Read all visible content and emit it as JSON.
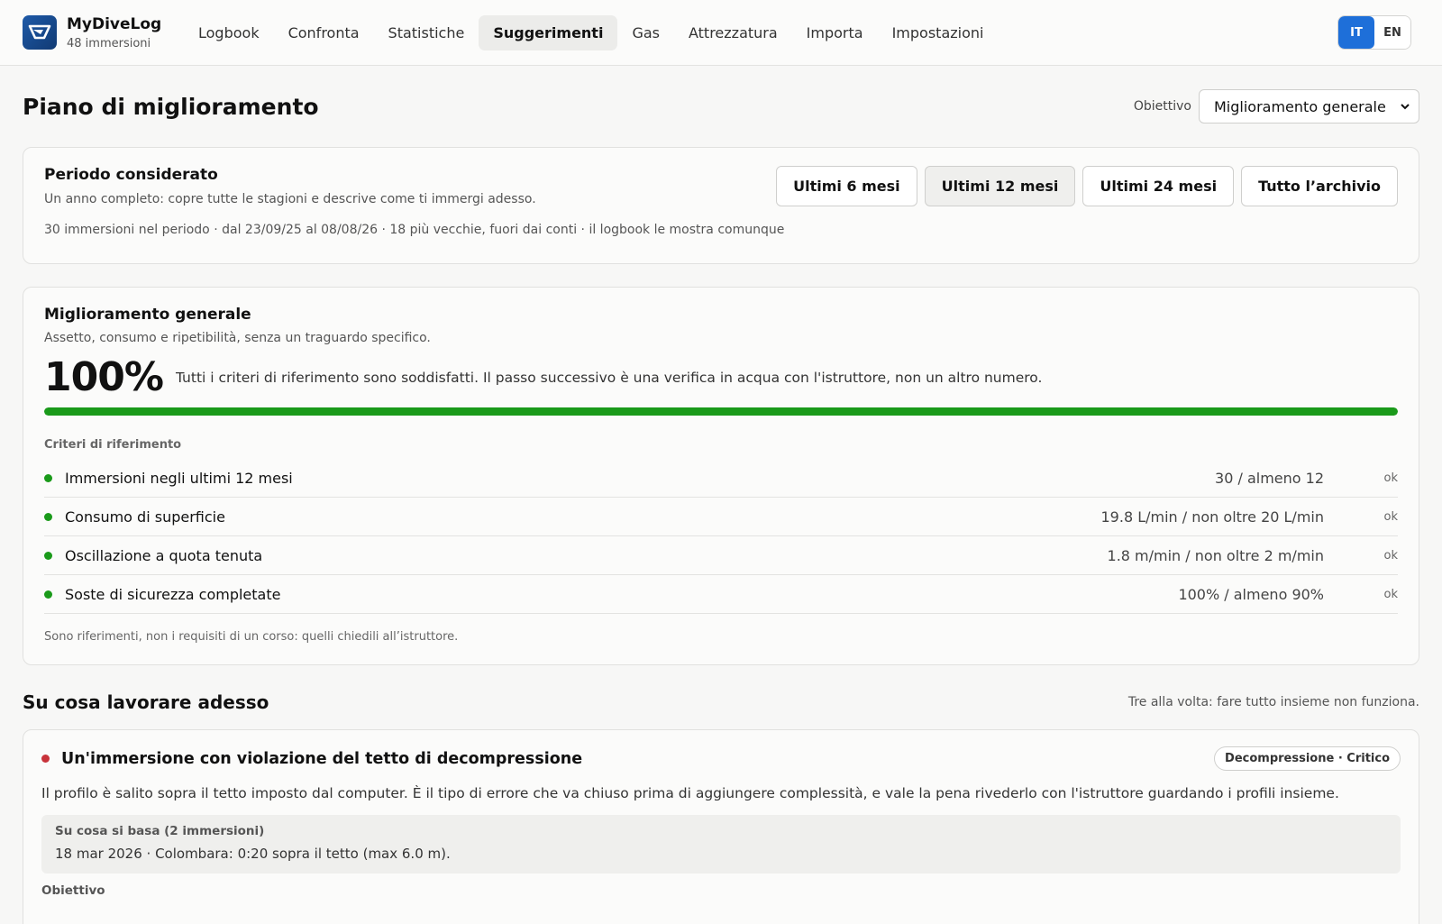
{
  "app": {
    "name": "MyDiveLog",
    "dive_count": "48 immersioni"
  },
  "nav": [
    {
      "label": "Logbook",
      "active": false
    },
    {
      "label": "Confronta",
      "active": false
    },
    {
      "label": "Statistiche",
      "active": false
    },
    {
      "label": "Suggerimenti",
      "active": true
    },
    {
      "label": "Gas",
      "active": false
    },
    {
      "label": "Attrezzatura",
      "active": false
    },
    {
      "label": "Importa",
      "active": false
    },
    {
      "label": "Impostazioni",
      "active": false
    }
  ],
  "lang": {
    "it": "IT",
    "en": "EN",
    "selected": "IT"
  },
  "page": {
    "title": "Piano di miglioramento",
    "objective_label": "Obiettivo",
    "objective_value": "Miglioramento generale"
  },
  "period": {
    "title": "Periodo considerato",
    "description": "Un anno completo: copre tutte le stagioni e descrive come ti immergi adesso.",
    "meta": "30 immersioni nel periodo · dal 23/09/25 al 08/08/26 · 18 più vecchie, fuori dai conti · il logbook le mostra comunque",
    "options": [
      "Ultimi 6 mesi",
      "Ultimi 12 mesi",
      "Ultimi 24 mesi",
      "Tutto l’archivio"
    ],
    "selected": "Ultimi 12 mesi"
  },
  "goal": {
    "title": "Miglioramento generale",
    "subtitle": "Assetto, consumo e ripetibilità, senza un traguardo specifico.",
    "percent": "100%",
    "progress": 1.0,
    "note": "Tutti i criteri di riferimento sono soddisfatti. Il passo successivo è una verifica in acqua con l'istruttore, non un altro numero.",
    "criteria_heading": "Criteri di riferimento",
    "criteria": [
      {
        "name": "Immersioni negli ultimi 12 mesi",
        "value": "30 / almeno 12",
        "status": "ok"
      },
      {
        "name": "Consumo di superficie",
        "value": "19.8 L/min / non oltre 20 L/min",
        "status": "ok"
      },
      {
        "name": "Oscillazione a quota tenuta",
        "value": "1.8 m/min / non oltre 2 m/min",
        "status": "ok"
      },
      {
        "name": "Soste di sicurezza completate",
        "value": "100% / almeno 90%",
        "status": "ok"
      }
    ],
    "footnote": "Sono riferimenti, non i requisiti di un corso: quelli chiedili all’istruttore."
  },
  "work": {
    "title": "Su cosa lavorare adesso",
    "note": "Tre alla volta: fare tutto insieme non funziona."
  },
  "issue": {
    "title": "Un'immersione con violazione del tetto di decompressione",
    "tag": "Decompressione · Critico",
    "body": "Il profilo è salito sopra il tetto imposto dal computer. È il tipo di errore che va chiuso prima di aggiungere complessità, e vale la pena rivederlo con l'istruttore guardando i profili insieme.",
    "basis_heading": "Su cosa si basa (2 immersioni)",
    "basis_text": "18 mar 2026 · Colombara: 0:20 sopra il tetto (max 6.0 m).",
    "objective_heading": "Obiettivo"
  },
  "colors": {
    "accent": "#1e6fd9",
    "ok": "#1a9a1a",
    "critical": "#c8323a"
  }
}
